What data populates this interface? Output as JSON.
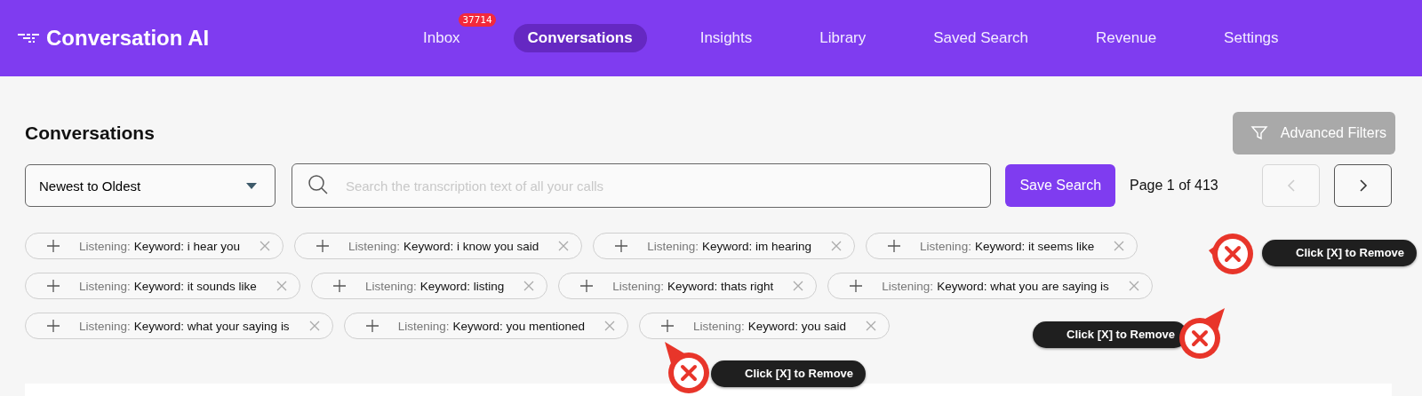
{
  "app": {
    "name": "Conversation AI"
  },
  "nav": [
    {
      "label": "Inbox",
      "badge": "37714",
      "selected": false
    },
    {
      "label": "Conversations",
      "selected": true
    },
    {
      "label": "Insights",
      "selected": false
    },
    {
      "label": "Library",
      "selected": false
    },
    {
      "label": "Saved Search",
      "selected": false
    },
    {
      "label": "Revenue",
      "selected": false
    },
    {
      "label": "Settings",
      "selected": false
    }
  ],
  "page": {
    "title": "Conversations",
    "advanced_filters": {
      "label": "Advanced Filters",
      "disabled": true
    }
  },
  "toolbar": {
    "sort": {
      "value": "Newest to Oldest"
    },
    "search": {
      "placeholder": "Search the transcription text of all your calls"
    },
    "save_button": "Save Search",
    "pagination": {
      "page": "1",
      "text_before": "Page",
      "text_after": "of 413",
      "prev_disabled": true,
      "next_disabled": false
    }
  },
  "filter_rows": [
    [
      {
        "category": "Listening:",
        "value": "Keyword: i hear you"
      },
      {
        "category": "Listening:",
        "value": "Keyword: i know you said"
      },
      {
        "category": "Listening:",
        "value": "Keyword: im hearing"
      },
      {
        "category": "Listening:",
        "value": "Keyword: it seems like"
      }
    ],
    [
      {
        "category": "Listening:",
        "value": "Keyword: it sounds like"
      },
      {
        "category": "Listening:",
        "value": "Keyword: listing"
      },
      {
        "category": "Listening:",
        "value": "Keyword: thats right"
      },
      {
        "category": "Listening:",
        "value": "Keyword: what you are saying is"
      }
    ],
    [
      {
        "category": "Listening:",
        "value": "Keyword: what your saying is"
      },
      {
        "category": "Listening:",
        "value": "Keyword: you mentioned"
      },
      {
        "category": "Listening:",
        "value": "Keyword: you said"
      }
    ]
  ],
  "callouts": [
    {
      "text": "Click [X] to Remove"
    },
    {
      "text": "Click [X] to Remove"
    },
    {
      "text": "Click [X] to Remove"
    }
  ]
}
